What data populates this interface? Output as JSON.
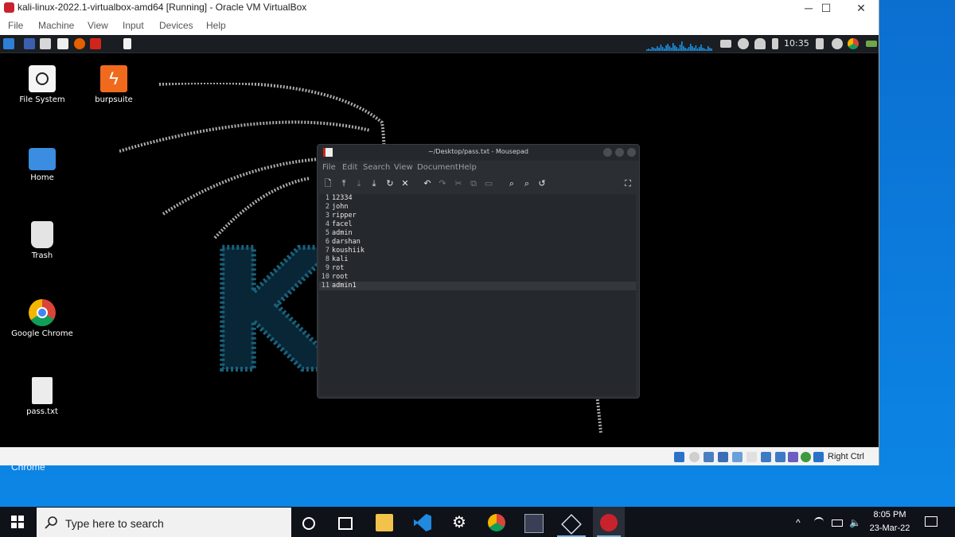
{
  "vbox": {
    "title": "kali-linux-2022.1-virtualbox-amd64 [Running] - Oracle VM VirtualBox",
    "menu": [
      "File",
      "Machine",
      "View",
      "Input",
      "Devices",
      "Help"
    ],
    "controls": {
      "minimize": "─",
      "maximize": "☐",
      "close": "✕"
    },
    "status_right": "Right Ctrl"
  },
  "guest_panel": {
    "clock": "10:35"
  },
  "desktop_icons": [
    {
      "label": "File System"
    },
    {
      "label": "burpsuite"
    },
    {
      "label": "Home"
    },
    {
      "label": "Trash"
    },
    {
      "label": "Google Chrome"
    },
    {
      "label": "pass.txt"
    }
  ],
  "mousepad": {
    "title": "~/Desktop/pass.txt - Mousepad",
    "menu": [
      "File",
      "Edit",
      "Search",
      "View",
      "Document",
      "Help"
    ],
    "lines": [
      {
        "n": "1",
        "text": "12334"
      },
      {
        "n": "2",
        "text": "john"
      },
      {
        "n": "3",
        "text": "ripper"
      },
      {
        "n": "4",
        "text": "facel"
      },
      {
        "n": "5",
        "text": "admin"
      },
      {
        "n": "6",
        "text": "darshan"
      },
      {
        "n": "7",
        "text": "koushiik"
      },
      {
        "n": "8",
        "text": "kali"
      },
      {
        "n": "9",
        "text": "rot"
      },
      {
        "n": "10",
        "text": "root"
      },
      {
        "n": "11",
        "text": "admin1"
      }
    ]
  },
  "host": {
    "chrome_label": "Chrome",
    "search_placeholder": "Type here to search",
    "time": "8:05 PM",
    "date": "23-Mar-22"
  },
  "colors": {
    "accent": "#0a78d7",
    "kali_blue": "#1e6fd9",
    "editor_bg": "#25282c"
  }
}
